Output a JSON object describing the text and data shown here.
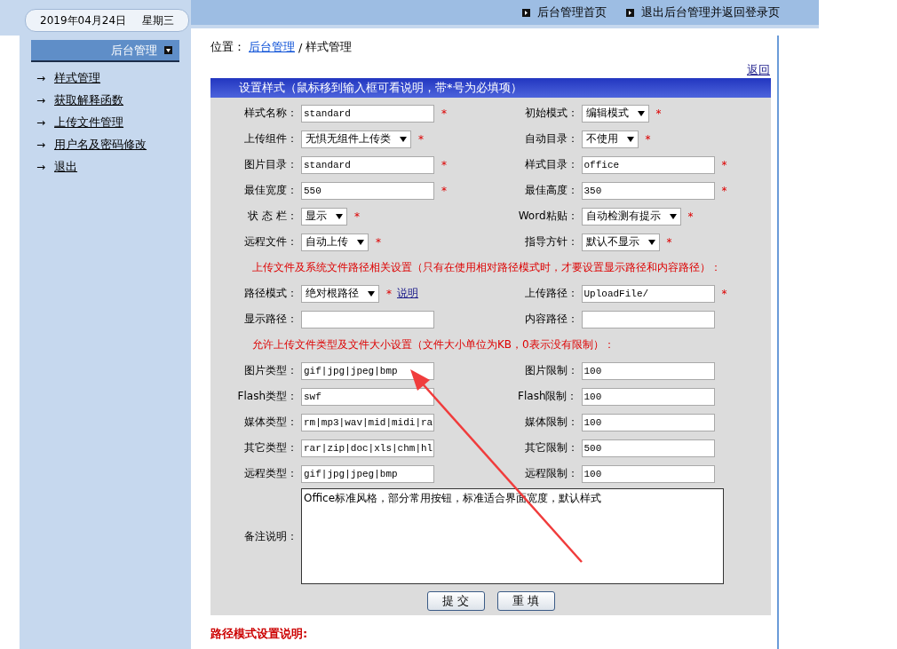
{
  "header": {
    "date": "2019年04月24日",
    "weekday": "星期三",
    "links": [
      "后台管理首页",
      "退出后台管理并返回登录页"
    ]
  },
  "sidebar": {
    "title": "后台管理",
    "bullet": "→",
    "items": [
      "样式管理",
      "获取解释函数",
      "上传文件管理",
      "用户名及密码修改",
      "退出"
    ]
  },
  "breadcrumb": {
    "prefix": "位置：",
    "link": "后台管理",
    "separator": "/",
    "current": "样式管理"
  },
  "back_link": "返回",
  "form": {
    "title": "设置样式（鼠标移到输入框可看说明，带*号为必填项）",
    "rows": [
      {
        "kind": "pair",
        "fields": [
          {
            "label": "样式名称：",
            "kind": "text",
            "value": "standard",
            "mark": "*"
          },
          {
            "label": "初始模式：",
            "kind": "select",
            "value": "编辑模式",
            "mark": "*"
          }
        ]
      },
      {
        "kind": "pair",
        "fields": [
          {
            "label": "上传组件：",
            "kind": "select",
            "value": "无惧无组件上传类",
            "mark": "*"
          },
          {
            "label": "自动目录：",
            "kind": "select",
            "value": "不使用",
            "mark": "*"
          }
        ]
      },
      {
        "kind": "pair",
        "fields": [
          {
            "label": "图片目录：",
            "kind": "text",
            "value": "standard",
            "mark": "*"
          },
          {
            "label": "样式目录：",
            "kind": "text",
            "value": "office",
            "mark": "*"
          }
        ]
      },
      {
        "kind": "pair",
        "fields": [
          {
            "label": "最佳宽度：",
            "kind": "text",
            "value": "550",
            "mark": "*"
          },
          {
            "label": "最佳高度：",
            "kind": "text",
            "value": "350",
            "mark": "*"
          }
        ]
      },
      {
        "kind": "pair",
        "fields": [
          {
            "label": "状 态 栏：",
            "kind": "select",
            "value": "显示",
            "mark": "*"
          },
          {
            "label": "Word粘贴：",
            "kind": "select",
            "value": "自动检测有提示",
            "mark": "*"
          }
        ]
      },
      {
        "kind": "pair",
        "fields": [
          {
            "label": "远程文件：",
            "kind": "select",
            "value": "自动上传",
            "mark": "*"
          },
          {
            "label": "指导方针：",
            "kind": "select",
            "value": "默认不显示",
            "mark": "*"
          }
        ]
      },
      {
        "kind": "note",
        "text": "上传文件及系统文件路径相关设置（只有在使用相对路径模式时，才要设置显示路径和内容路径）："
      },
      {
        "kind": "pair",
        "fields": [
          {
            "label": "路径模式：",
            "kind": "select",
            "value": "绝对根路径",
            "mark": "*",
            "link": "说明"
          },
          {
            "label": "上传路径：",
            "kind": "text",
            "value": "UploadFile/",
            "mark": "*"
          }
        ]
      },
      {
        "kind": "pair",
        "fields": [
          {
            "label": "显示路径：",
            "kind": "text"
          },
          {
            "label": "内容路径：",
            "kind": "text"
          }
        ]
      },
      {
        "kind": "note",
        "text": "允许上传文件类型及文件大小设置（文件大小单位为KB，0表示没有限制）："
      },
      {
        "kind": "pair",
        "fields": [
          {
            "label": "图片类型：",
            "kind": "text",
            "value": "gif|jpg|jpeg|bmp"
          },
          {
            "label": "图片限制：",
            "kind": "text",
            "value": "100"
          }
        ]
      },
      {
        "kind": "pair",
        "fields": [
          {
            "label": "Flash类型：",
            "kind": "text",
            "value": "swf"
          },
          {
            "label": "Flash限制：",
            "kind": "text",
            "value": "100"
          }
        ]
      },
      {
        "kind": "pair",
        "fields": [
          {
            "label": "媒体类型：",
            "kind": "text",
            "value": "rm|mp3|wav|mid|midi|ra"
          },
          {
            "label": "媒体限制：",
            "kind": "text",
            "value": "100"
          }
        ]
      },
      {
        "kind": "pair",
        "fields": [
          {
            "label": "其它类型：",
            "kind": "text",
            "value": "rar|zip|doc|xls|chm|hl"
          },
          {
            "label": "其它限制：",
            "kind": "text",
            "value": "500"
          }
        ]
      },
      {
        "kind": "pair",
        "fields": [
          {
            "label": "远程类型：",
            "kind": "text",
            "value": "gif|jpg|jpeg|bmp"
          },
          {
            "label": "远程限制：",
            "kind": "text",
            "value": "100"
          }
        ]
      },
      {
        "kind": "textarea",
        "label": "备注说明：",
        "value": "Office标准风格，部分常用按钮，标准适合界面宽度，默认样式"
      }
    ],
    "buttons": [
      "提 交",
      "重 填"
    ]
  },
  "footer_heading": "路径模式设置说明:"
}
